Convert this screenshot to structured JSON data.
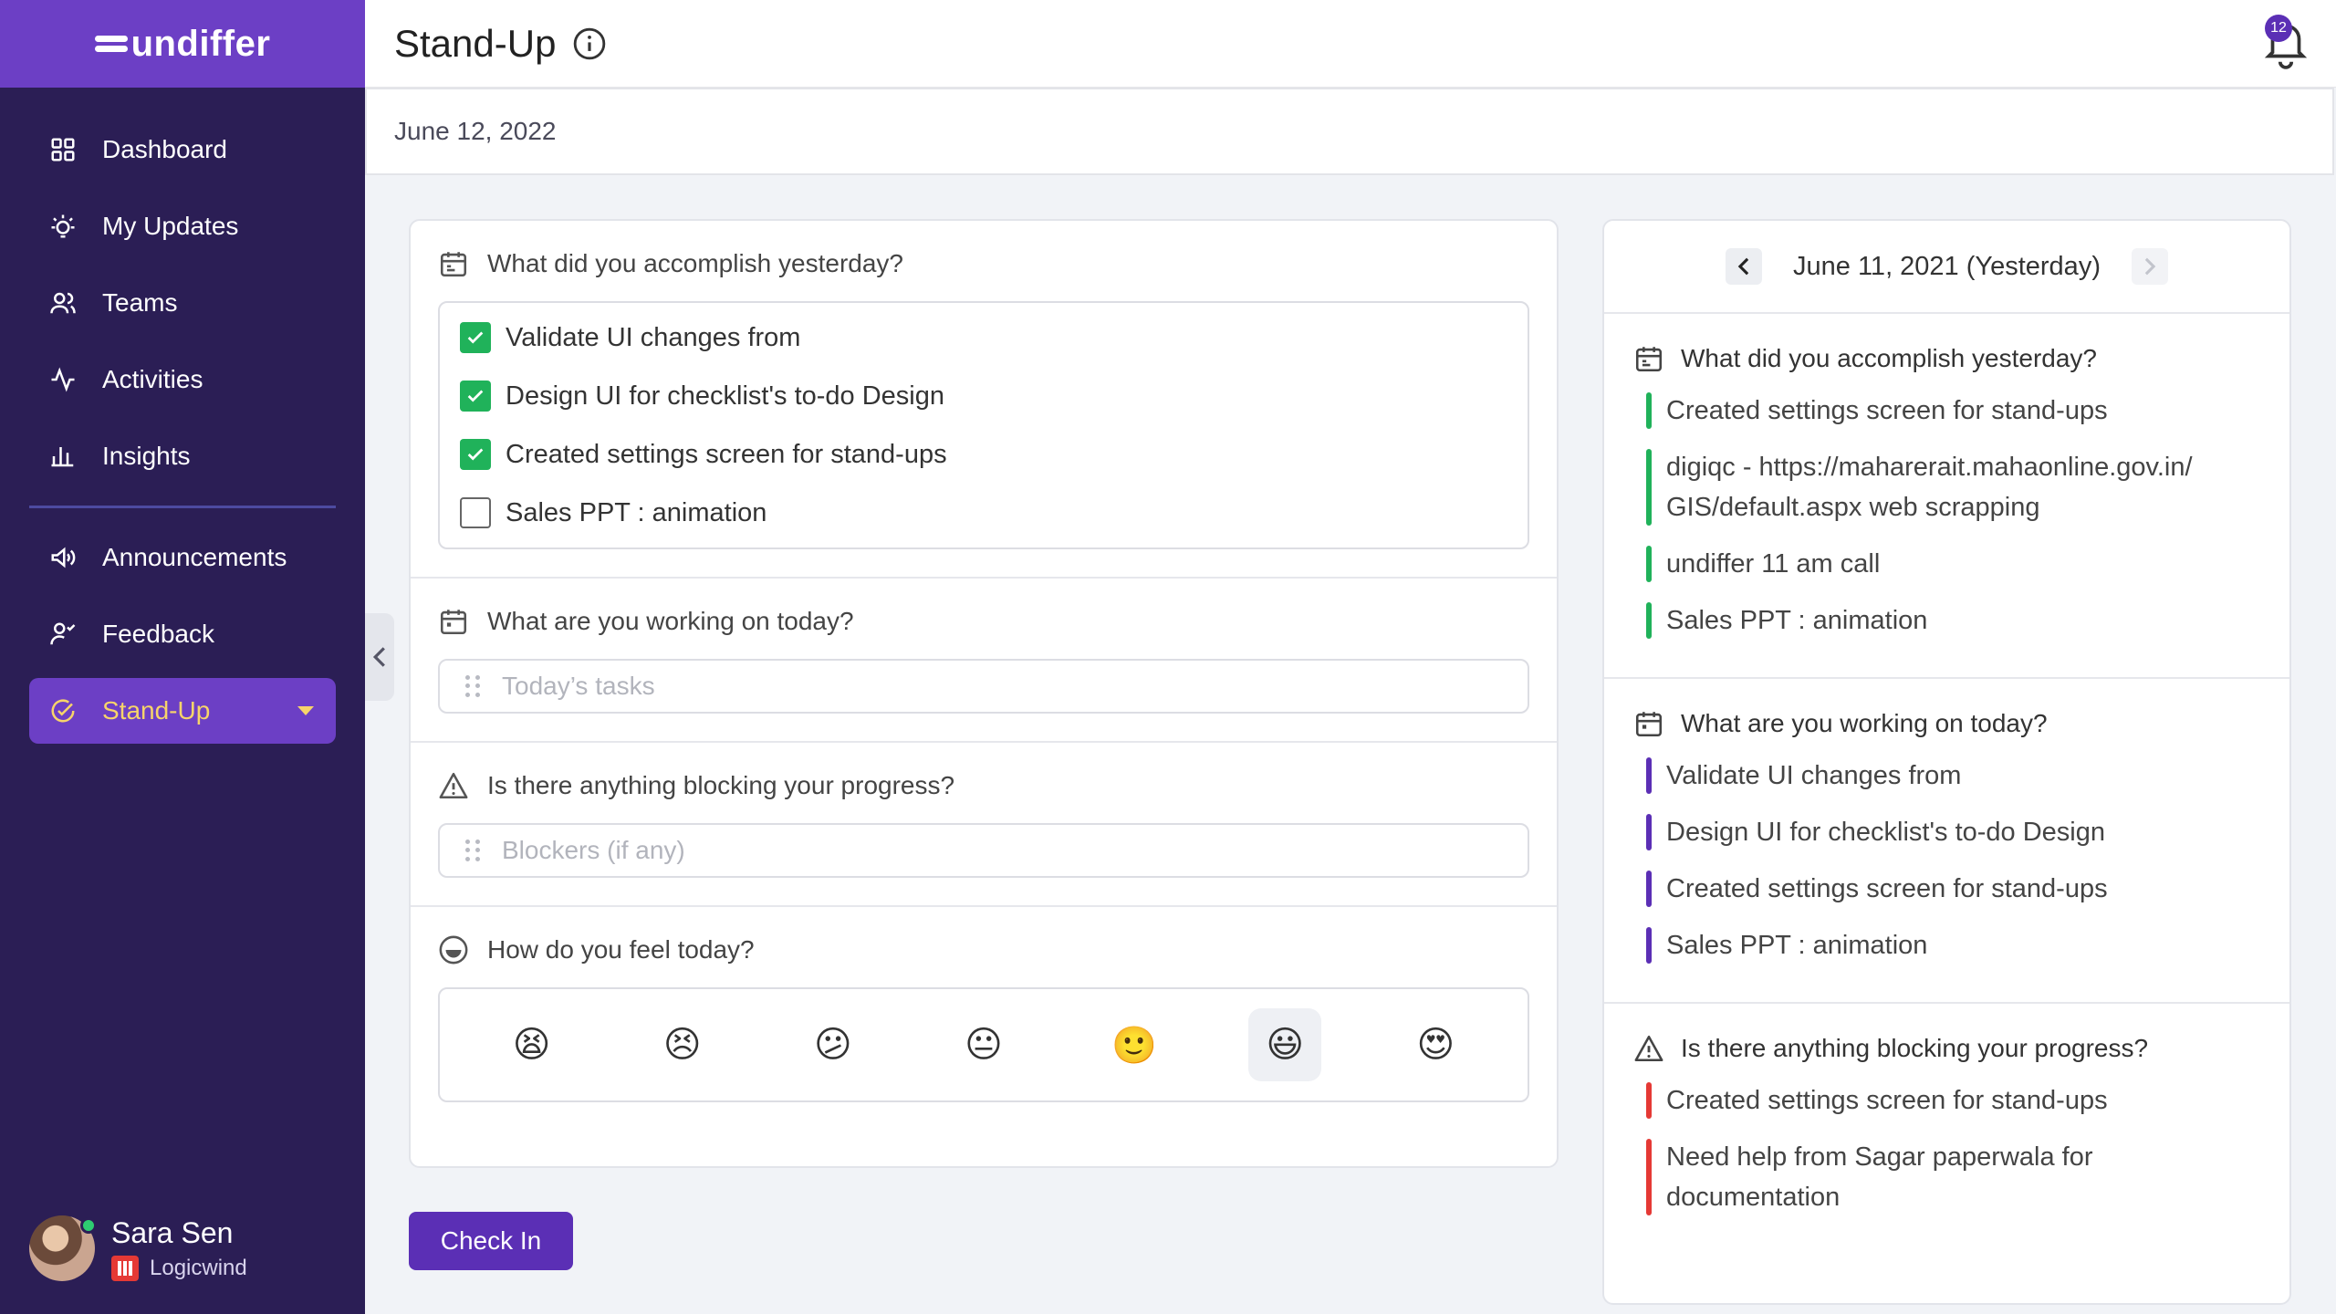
{
  "brand": {
    "name": "undiffer"
  },
  "sidebar": {
    "items": [
      {
        "label": "Dashboard",
        "icon": "grid-icon"
      },
      {
        "label": "My Updates",
        "icon": "bulb-icon"
      },
      {
        "label": "Teams",
        "icon": "users-icon"
      },
      {
        "label": "Activities",
        "icon": "activity-icon"
      },
      {
        "label": "Insights",
        "icon": "bar-chart-icon"
      },
      {
        "label": "Announcements",
        "icon": "megaphone-icon"
      },
      {
        "label": "Feedback",
        "icon": "feedback-icon"
      },
      {
        "label": "Stand-Up",
        "icon": "check-circle-icon",
        "active": true
      }
    ]
  },
  "user": {
    "name": "Sara Sen",
    "org": "Logicwind"
  },
  "header": {
    "title": "Stand-Up",
    "notification_count": "12"
  },
  "date_label": "June 12, 2022",
  "form": {
    "q_yesterday": "What did you accomplish yesterday?",
    "yesterday_items": [
      {
        "text": "Validate UI changes from",
        "checked": true
      },
      {
        "text": "Design UI for checklist's to-do Design",
        "checked": true
      },
      {
        "text": "Created settings screen for stand-ups",
        "checked": true
      },
      {
        "text": "Sales PPT : animation",
        "checked": false
      }
    ],
    "q_today": "What are you working on today?",
    "today_placeholder": "Today’s tasks",
    "q_blockers": "Is there anything blocking your progress?",
    "blockers_placeholder": "Blockers (if any)",
    "q_feel": "How do you feel today?",
    "moods": [
      "😫",
      "😣",
      "😕",
      "😐",
      "🙂",
      "😃",
      "😍"
    ],
    "selected_mood_index": 5,
    "checkin_label": "Check In"
  },
  "history": {
    "date": "June 11, 2021 (Yesterday)",
    "q_yesterday": "What did you accomplish yesterday?",
    "yesterday": [
      "Created settings screen for stand-ups",
      "digiqc - https://maharerait.mahaonline.gov.in/ GIS/default.aspx web scrapping",
      "undiffer 11 am call",
      "Sales PPT : animation"
    ],
    "q_today": "What are you working on today?",
    "today": [
      "Validate UI changes from",
      "Design UI for checklist's to-do Design",
      "Created settings screen for stand-ups",
      "Sales PPT : animation"
    ],
    "q_blockers": "Is there anything blocking your progress?",
    "blockers": [
      "Created settings screen for stand-ups",
      "Need help from Sagar paperwala for documentation"
    ]
  },
  "colors": {
    "sidebar": "#2b1e55",
    "brand": "#6c3fc5",
    "active_text": "#f7d46a",
    "green": "#20b25a",
    "purple": "#5b2fb5",
    "red": "#e53935"
  }
}
